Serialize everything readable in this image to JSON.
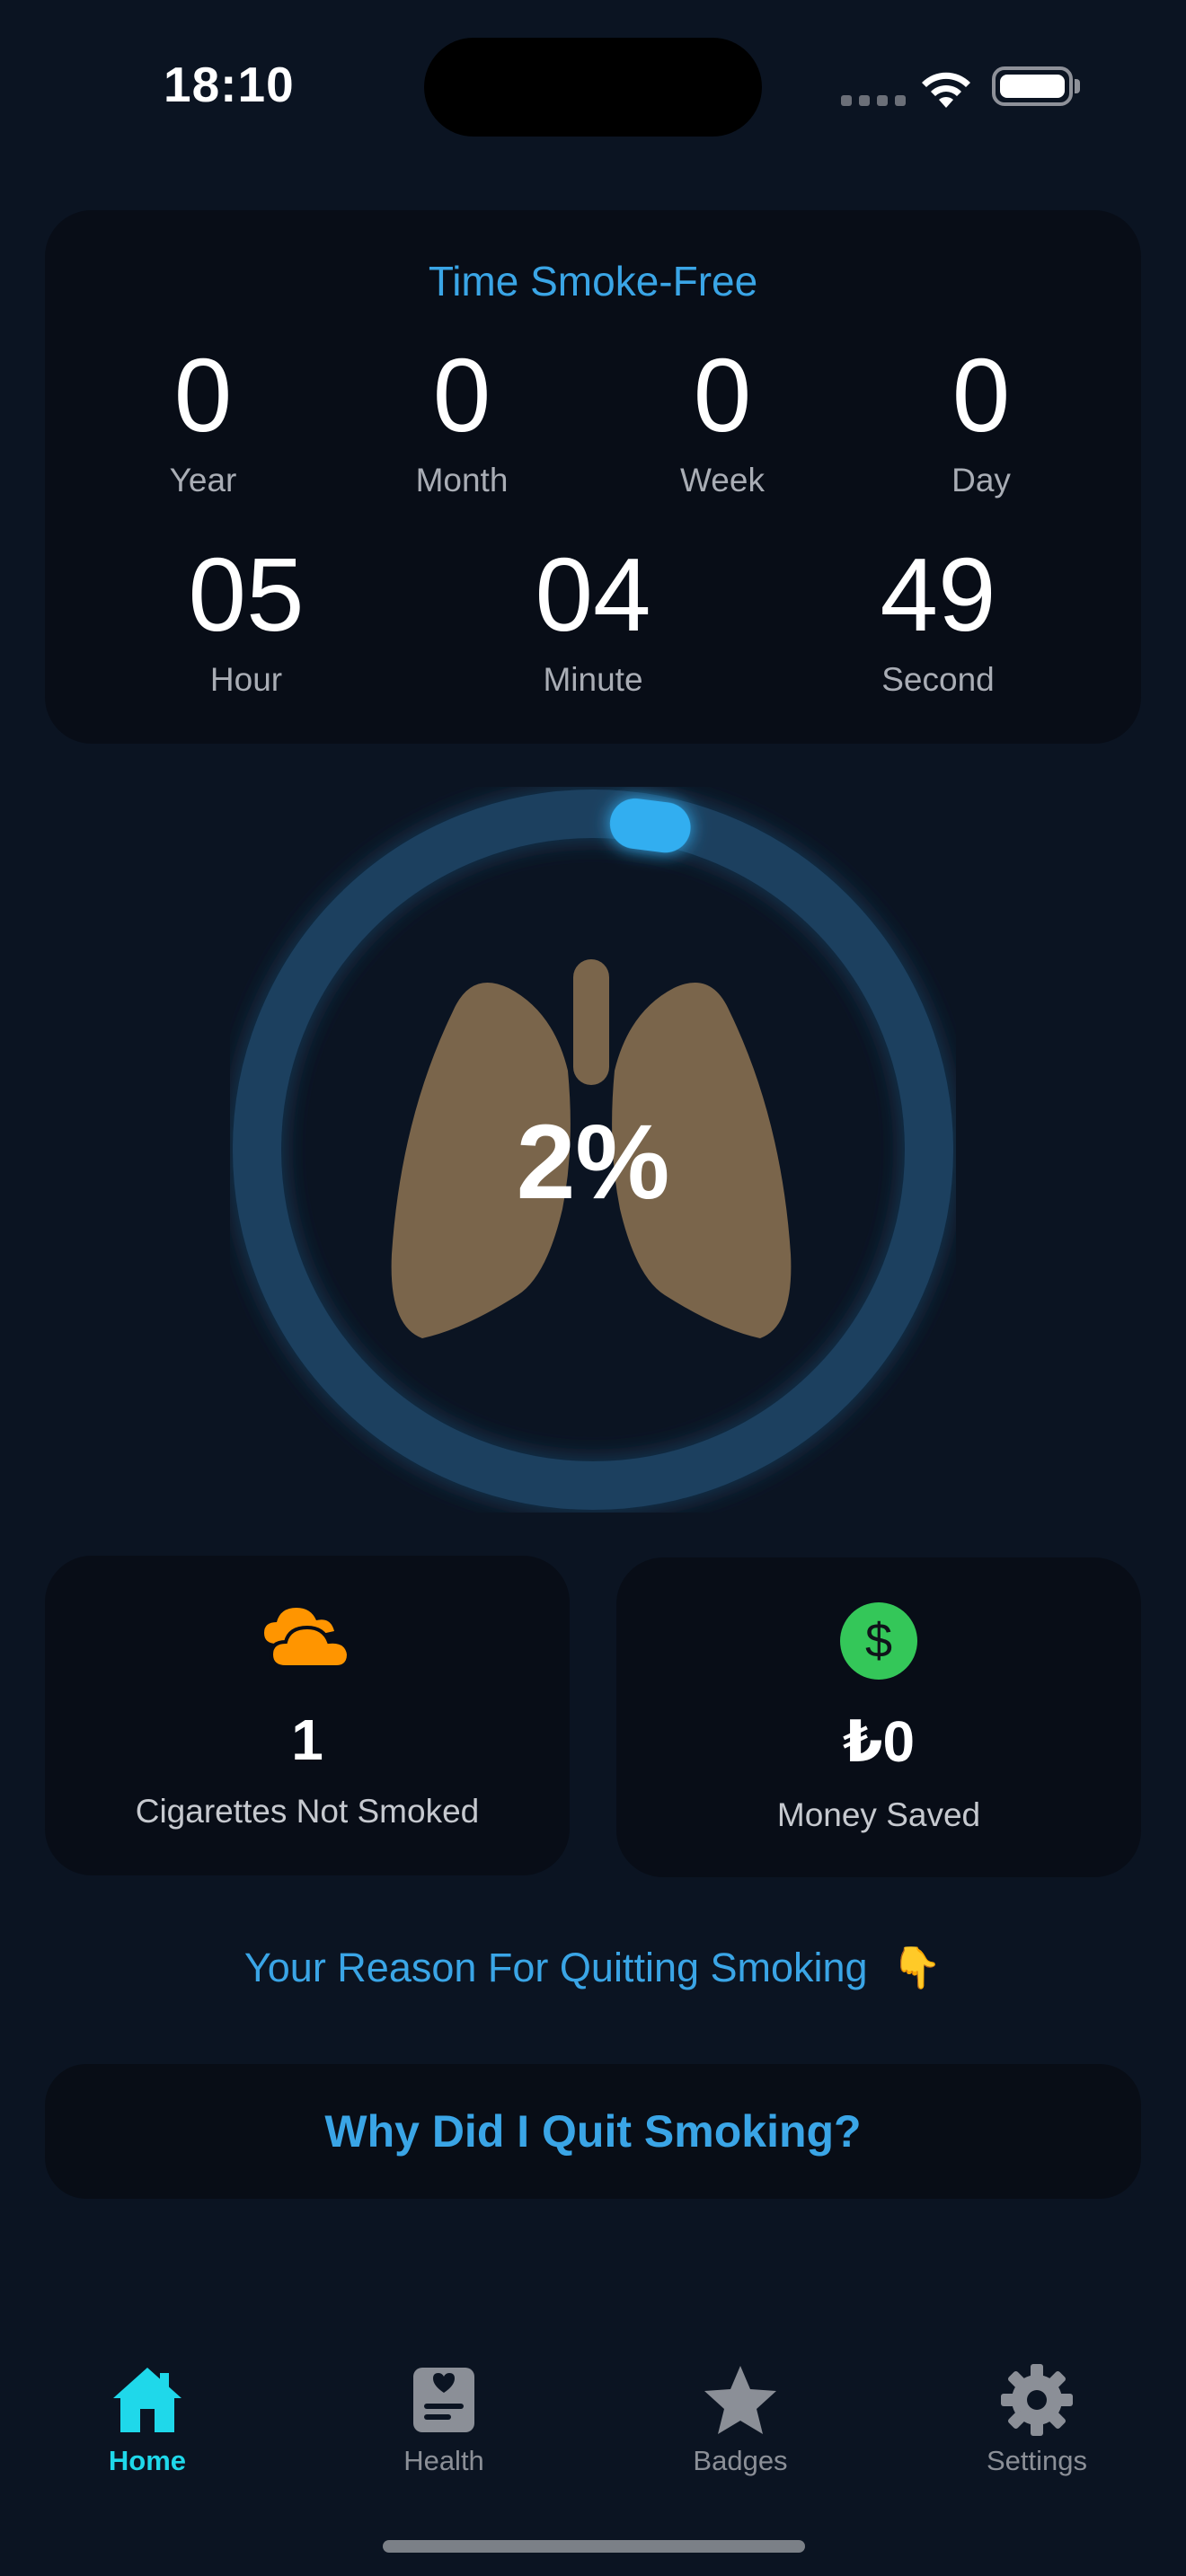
{
  "status_bar": {
    "time": "18:10"
  },
  "time_card": {
    "title": "Time Smoke-Free",
    "units_top": [
      {
        "value": "0",
        "label": "Year"
      },
      {
        "value": "0",
        "label": "Month"
      },
      {
        "value": "0",
        "label": "Week"
      },
      {
        "value": "0",
        "label": "Day"
      }
    ],
    "units_bottom": [
      {
        "value": "05",
        "label": "Hour"
      },
      {
        "value": "04",
        "label": "Minute"
      },
      {
        "value": "49",
        "label": "Second"
      }
    ]
  },
  "progress": {
    "label": "2%",
    "fraction": 0.02,
    "ring_color": "#1b3f5e",
    "knob_color": "#33aef0",
    "lungs_color": "#7a654b"
  },
  "stats": {
    "cigarettes": {
      "value": "1",
      "label": "Cigarettes Not Smoked",
      "icon": "cloud-icon",
      "icon_color": "#ff9500"
    },
    "money": {
      "value": "₺0",
      "label": "Money Saved",
      "icon": "dollar-icon",
      "icon_color": "#34c759",
      "icon_glyph": "$"
    }
  },
  "reason": {
    "label": "Your Reason For Quitting Smoking",
    "emoji": "👇"
  },
  "why_button": {
    "label": "Why Did I Quit Smoking?"
  },
  "tabs": [
    {
      "label": "Home",
      "icon": "house-icon",
      "active": true
    },
    {
      "label": "Health",
      "icon": "health-icon",
      "active": false
    },
    {
      "label": "Badges",
      "icon": "star-icon",
      "active": false
    },
    {
      "label": "Settings",
      "icon": "gear-icon",
      "active": false
    }
  ],
  "colors": {
    "background": "#0b1422",
    "accent": "#3aa5e6",
    "tab_active": "#1fd8ea"
  }
}
